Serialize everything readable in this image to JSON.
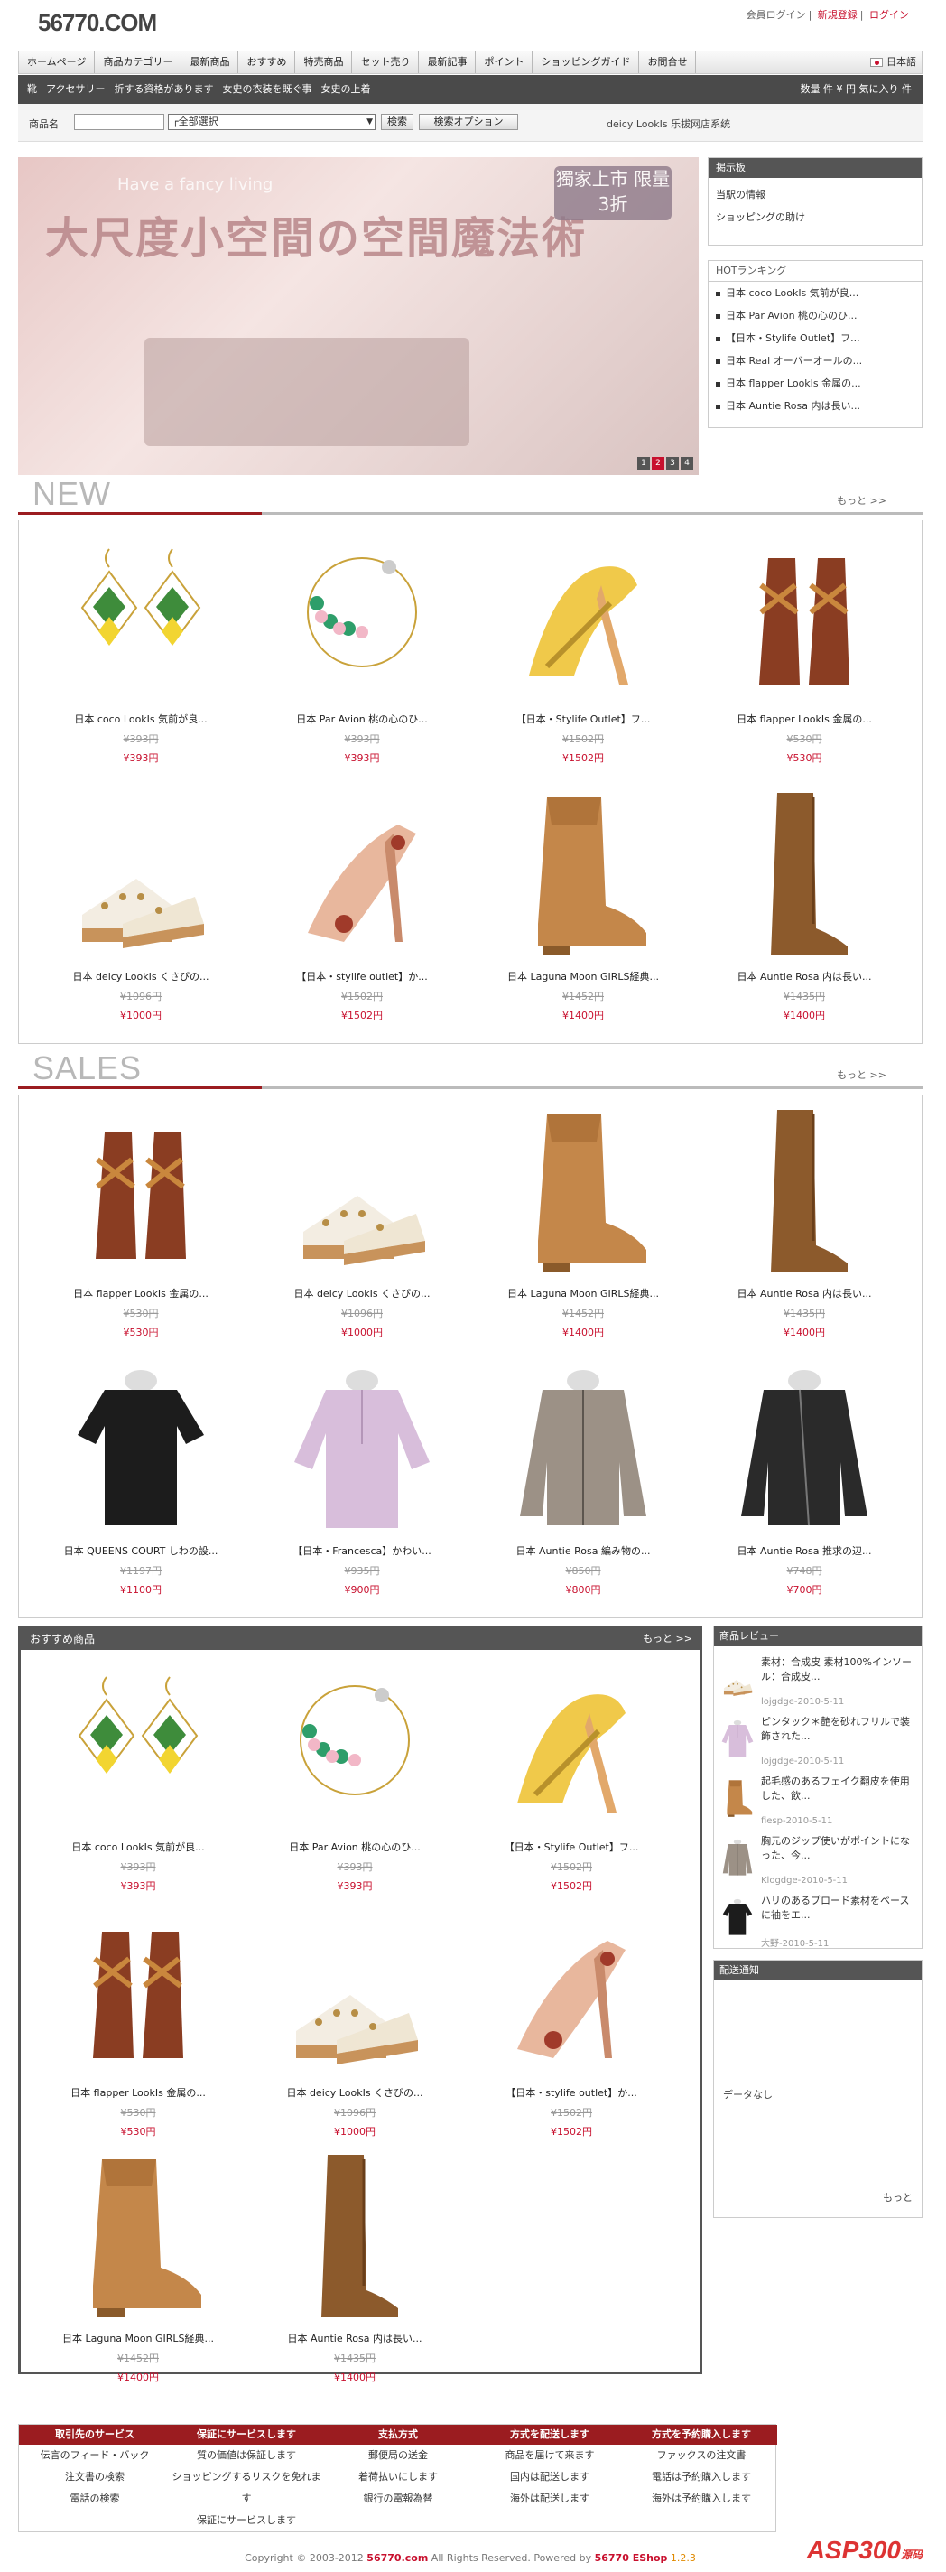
{
  "header": {
    "logo": "56770.COM",
    "links": [
      "会員ログイン",
      "新規登録",
      "ログイン"
    ],
    "separators": "|"
  },
  "nav": {
    "items": [
      "ホームページ",
      "商品カテゴリー",
      "最新商品",
      "おすすめ",
      "特売商品",
      "セット売り",
      "最新記事",
      "ポイント",
      "ショッピングガイド",
      "お問合せ"
    ],
    "language": "日本語"
  },
  "subnav": {
    "items": [
      "靴",
      "アクセサリー",
      "折する資格があります",
      "女史の衣装を既ぐ事",
      "女史の上着"
    ],
    "cart": "数量  件 ¥ 円  気に入り  件"
  },
  "search": {
    "label": "商品名",
    "value": "",
    "select": "┌全部選択",
    "button": "検索",
    "option_button": "検索オプション",
    "system_name": "deicy LookIs 乐拔网店系统"
  },
  "banner": {
    "big_text": "大尺度小空間の空間魔法術",
    "sub_text": "Have a fancy living",
    "tag": "獨家上市 限量3折",
    "dots": [
      "1",
      "2",
      "3",
      "4"
    ]
  },
  "board": {
    "title": "掲示板",
    "items": [
      "当駅の情報",
      "ショッピングの助け"
    ]
  },
  "hot": {
    "title": "HOTランキング",
    "items": [
      "日本 coco LookIs 気前が良...",
      "日本 Par Avion 桃の心のひ...",
      "【日本・Stylife Outlet】フ...",
      "日本 Real オーバーオールの...",
      "日本 flapper LookIs 金属の...",
      "日本 Auntie Rosa 内は長い..."
    ]
  },
  "new_section": {
    "title": "NEW",
    "more": "もっと >>",
    "products": [
      {
        "name": "日本 coco LookIs 気前が良...",
        "old": "¥393円",
        "price": "¥393円",
        "icon": "earring-icon"
      },
      {
        "name": "日本 Par Avion 桃の心のひ...",
        "old": "¥393円",
        "price": "¥393円",
        "icon": "hoop-earring-icon"
      },
      {
        "name": "【日本・Stylife Outlet】フ...",
        "old": "¥1502円",
        "price": "¥1502円",
        "icon": "yellow-sandal-icon"
      },
      {
        "name": "日本 flapper LookIs 金属の...",
        "old": "¥530円",
        "price": "¥530円",
        "icon": "brown-sandal-icon"
      },
      {
        "name": "日本 deicy LookIs くさびの...",
        "old": "¥1096円",
        "price": "¥1000円",
        "icon": "white-sandal-icon"
      },
      {
        "name": "【日本・stylife outlet】か...",
        "old": "¥1502円",
        "price": "¥1502円",
        "icon": "pink-shoe-icon"
      },
      {
        "name": "日本 Laguna Moon GIRLS経典...",
        "old": "¥1452円",
        "price": "¥1400円",
        "icon": "cowboy-boot-icon"
      },
      {
        "name": "日本 Auntie Rosa 内は長い...",
        "old": "¥1435円",
        "price": "¥1400円",
        "icon": "tall-boot-icon"
      }
    ]
  },
  "sales_section": {
    "title": "SALES",
    "more": "もっと >>",
    "products": [
      {
        "name": "日本 flapper LookIs 金属の...",
        "old": "¥530円",
        "price": "¥530円",
        "icon": "brown-sandal-icon"
      },
      {
        "name": "日本 deicy LookIs くさびの...",
        "old": "¥1096円",
        "price": "¥1000円",
        "icon": "white-sandal-icon"
      },
      {
        "name": "日本 Laguna Moon GIRLS経典...",
        "old": "¥1452円",
        "price": "¥1400円",
        "icon": "cowboy-boot-icon"
      },
      {
        "name": "日本 Auntie Rosa 内は長い...",
        "old": "¥1435円",
        "price": "¥1400円",
        "icon": "tall-boot-icon"
      },
      {
        "name": "日本 QUEENS COURT しわの設...",
        "old": "¥1197円",
        "price": "¥1100円",
        "icon": "black-shirt-icon"
      },
      {
        "name": "【日本・Francesca】かわい...",
        "old": "¥935円",
        "price": "¥900円",
        "icon": "lilac-blouse-icon"
      },
      {
        "name": "日本 Auntie Rosa 編み物の...",
        "old": "¥850円",
        "price": "¥800円",
        "icon": "khaki-jacket-icon"
      },
      {
        "name": "日本 Auntie Rosa 推求の辺...",
        "old": "¥748円",
        "price": "¥700円",
        "icon": "leather-jacket-icon"
      }
    ]
  },
  "recommend": {
    "title": "おすすめ商品",
    "more": "もっと >>",
    "products": [
      {
        "name": "日本 coco LookIs 気前が良...",
        "old": "¥393円",
        "price": "¥393円",
        "icon": "earring-icon"
      },
      {
        "name": "日本 Par Avion 桃の心のひ...",
        "old": "¥393円",
        "price": "¥393円",
        "icon": "hoop-earring-icon"
      },
      {
        "name": "【日本・Stylife Outlet】フ...",
        "old": "¥1502円",
        "price": "¥1502円",
        "icon": "yellow-sandal-icon"
      },
      {
        "name": "日本 flapper LookIs 金属の...",
        "old": "¥530円",
        "price": "¥530円",
        "icon": "brown-sandal-icon"
      },
      {
        "name": "日本 deicy LookIs くさびの...",
        "old": "¥1096円",
        "price": "¥1000円",
        "icon": "white-sandal-icon"
      },
      {
        "name": "【日本・stylife outlet】か...",
        "old": "¥1502円",
        "price": "¥1502円",
        "icon": "pink-shoe-icon"
      },
      {
        "name": "日本 Laguna Moon GIRLS経典...",
        "old": "¥1452円",
        "price": "¥1400円",
        "icon": "cowboy-boot-icon"
      },
      {
        "name": "日本 Auntie Rosa 内は長い...",
        "old": "¥1435円",
        "price": "¥1400円",
        "icon": "tall-boot-icon"
      }
    ]
  },
  "reviews": {
    "title": "商品レビュー",
    "items": [
      {
        "text": "素材：合成皮 素材100%インソール：合成皮...",
        "date": "lojgdge-2010-5-11",
        "icon": "white-sandal-icon"
      },
      {
        "text": "ピンタック＊艶を砂れフリルで装飾された...",
        "date": "lojgdge-2010-5-11",
        "icon": "lilac-blouse-icon"
      },
      {
        "text": "起毛感のあるフェイク翻皮を使用した、飲...",
        "date": "fiesp-2010-5-11",
        "icon": "cowboy-boot-icon"
      },
      {
        "text": "胸元のジップ使いがポイントになった、今...",
        "date": "Klogdge-2010-5-11",
        "icon": "khaki-jacket-icon"
      },
      {
        "text": "ハリのあるブロード素材をベースに袖をエ...",
        "date": "大野-2010-5-11",
        "icon": "black-shirt-icon"
      }
    ]
  },
  "notice": {
    "title": "配送通知",
    "empty": "データなし",
    "more": "もっと"
  },
  "footer": {
    "columns": [
      {
        "title": "取引先のサービス",
        "links": [
          "伝言のフィード・バック",
          "注文書の検索",
          "電話の検索"
        ]
      },
      {
        "title": "保証にサービスします",
        "links": [
          "質の価値は保証します",
          "ショッピングするリスクを免れます",
          "保証にサービスします"
        ]
      },
      {
        "title": "支払方式",
        "links": [
          "郵便局の送金",
          "着荷払いにします",
          "銀行の電報為替"
        ]
      },
      {
        "title": "方式を配送します",
        "links": [
          "商品を届けて来ます",
          "国内は配送します",
          "海外は配送します"
        ]
      },
      {
        "title": "方式を予約購入します",
        "links": [
          "ファックスの注文書",
          "電話は予約購入します",
          "海外は予約購入します"
        ]
      }
    ],
    "copyright": "Copyright © 2003-2012",
    "site": "56770.com",
    "rights": "All Rights Reserved.",
    "powered": "Powered by",
    "engine": "56770 EShop",
    "version": "1.2.3",
    "watermark": "ASP300",
    "watermark_sub": "源码"
  },
  "colors": {
    "accent": "#c8102e",
    "dark": "#555555",
    "footer_head": "#9b1c20"
  }
}
